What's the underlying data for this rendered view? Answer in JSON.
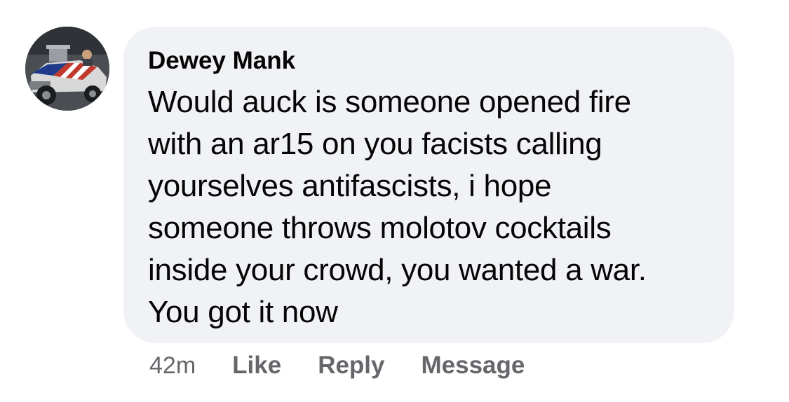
{
  "comment": {
    "author": "Dewey Mank",
    "avatar_icon": "profile-photo-car-flag",
    "text_lines": [
      "Would auck is someone opened fire",
      "with an ar15 on you facists calling",
      "yourselves antifascists, i hope",
      "someone throws molotov cocktails",
      "inside your crowd, you wanted a war.",
      "You got it now"
    ],
    "time": "42m",
    "actions": {
      "like": "Like",
      "reply": "Reply",
      "message": "Message"
    }
  },
  "colors": {
    "bubble_bg": "#f0f2f5",
    "text": "#050505",
    "meta": "#65676b"
  }
}
